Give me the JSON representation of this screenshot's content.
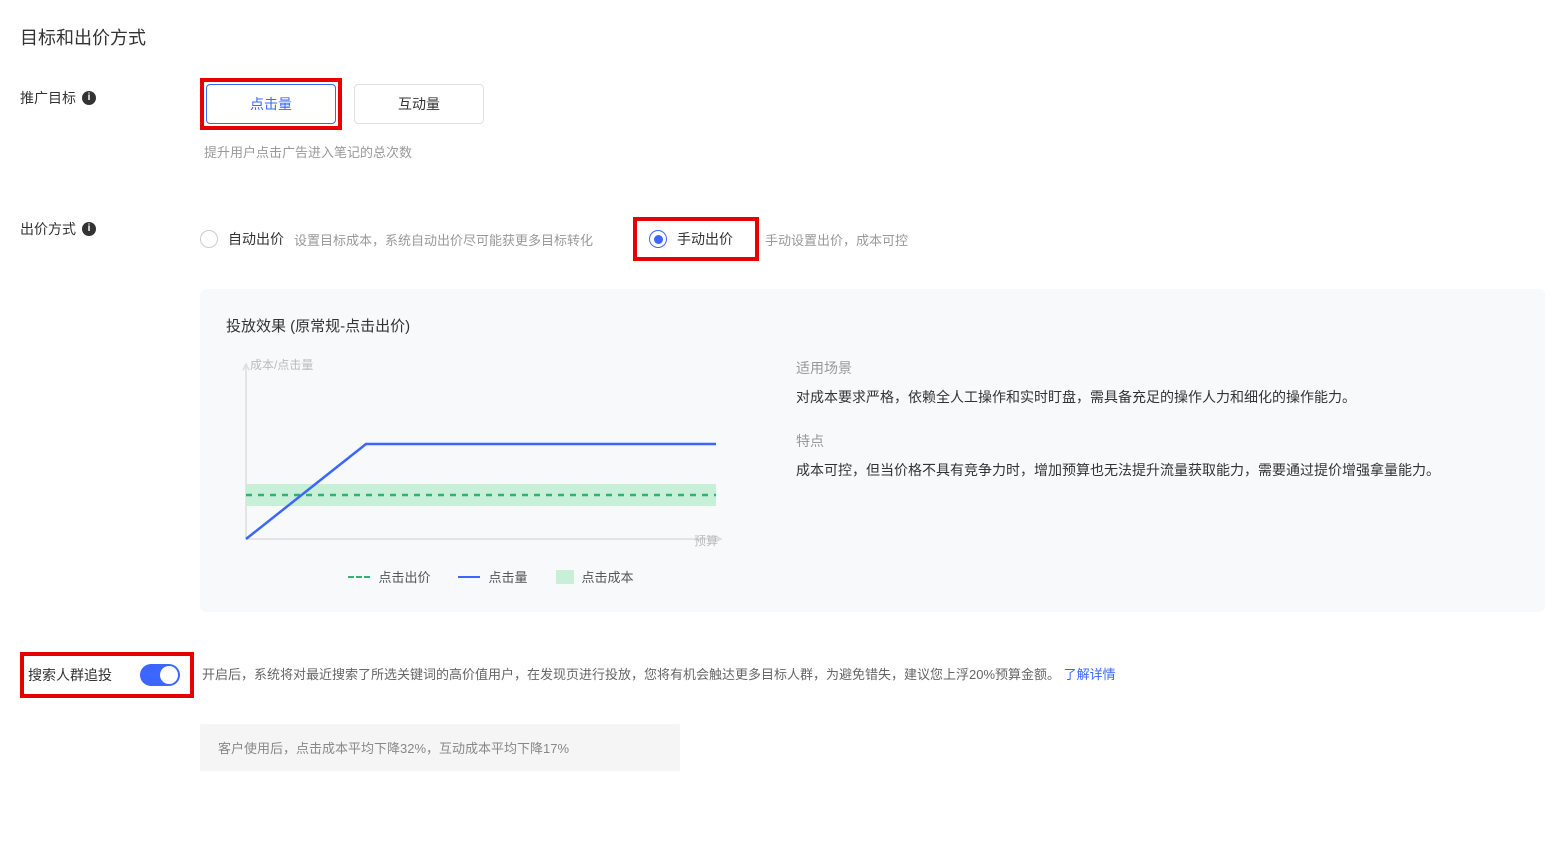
{
  "section_title": "目标和出价方式",
  "promo_target": {
    "label": "推广目标",
    "options": [
      "点击量",
      "互动量"
    ],
    "selected": 0,
    "desc": "提升用户点击广告进入笔记的总次数"
  },
  "bid_method": {
    "label": "出价方式",
    "options": [
      {
        "label": "自动出价",
        "desc": "设置目标成本，系统自动出价尽可能获更多目标转化",
        "checked": false
      },
      {
        "label": "手动出价",
        "desc": "手动设置出价，成本可控",
        "checked": true
      }
    ]
  },
  "effect": {
    "title": "投放效果 (原常规-点击出价)",
    "ylabel": "成本/点击量",
    "xlabel": "预算",
    "legend": {
      "dash": "点击出价",
      "line": "点击量",
      "block": "点击成本"
    },
    "scenario_label": "适用场景",
    "scenario_text": "对成本要求严格，依赖全人工操作和实时盯盘，需具备充足的操作人力和细化的操作能力。",
    "feature_label": "特点",
    "feature_text": "成本可控，但当价格不具有竞争力时，增加预算也无法提升流量获取能力，需要通过提价增强拿量能力。"
  },
  "search_retarget": {
    "label": "搜索人群追投",
    "enabled": true,
    "desc": "开启后，系统将对最近搜索了所选关键词的高价值用户，在发现页进行投放，您将有机会触达更多目标人群，为避免错失，建议您上浮20%预算金额。",
    "link": "了解详情",
    "stats": "客户使用后，点击成本平均下降32%，互动成本平均下降17%"
  },
  "chart_data": {
    "type": "line",
    "title": "投放效果 (原常规-点击出价)",
    "xlabel": "预算",
    "ylabel": "成本/点击量",
    "series": [
      {
        "name": "点击出价",
        "style": "dashed",
        "color": "#2bb673",
        "x": [
          0,
          100
        ],
        "y": [
          32,
          32
        ]
      },
      {
        "name": "点击量",
        "style": "solid",
        "color": "#3b66ff",
        "x": [
          0,
          30,
          100
        ],
        "y": [
          0,
          60,
          60
        ]
      }
    ],
    "area": {
      "name": "点击成本",
      "color": "#c8efd8",
      "y_range": [
        26,
        38
      ],
      "x_range": [
        0,
        100
      ]
    },
    "xlim": [
      0,
      100
    ],
    "ylim": [
      0,
      100
    ]
  }
}
